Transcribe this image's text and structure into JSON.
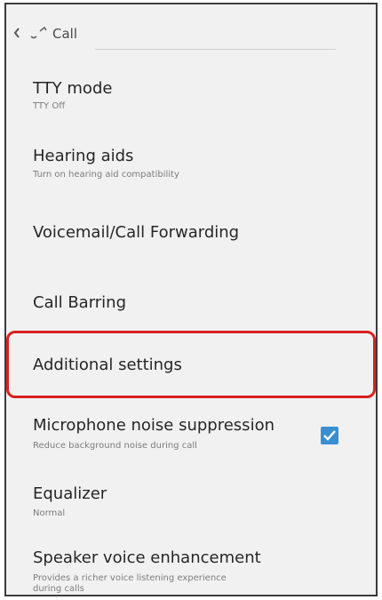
{
  "header": {
    "title": "Call"
  },
  "items": [
    {
      "title": "TTY mode",
      "summary": "TTY Off"
    },
    {
      "title": "Hearing aids",
      "summary": "Turn on hearing aid compatibility"
    },
    {
      "title": "Voicemail/Call Forwarding"
    },
    {
      "title": "Call Barring"
    },
    {
      "title": "Additional settings"
    },
    {
      "title": "Microphone noise suppression",
      "summary": "Reduce background noise during call",
      "checked": true
    },
    {
      "title": "Equalizer",
      "summary": "Normal"
    },
    {
      "title": "Speaker voice enhancement",
      "summary": "Provides a richer voice listening experience during calls"
    }
  ],
  "icons": {
    "back": "chevron-left-icon",
    "app": "phone-icon",
    "checkbox": "check-icon"
  },
  "colors": {
    "highlight": "#d82020",
    "checkbox": "#3b8fd1"
  }
}
